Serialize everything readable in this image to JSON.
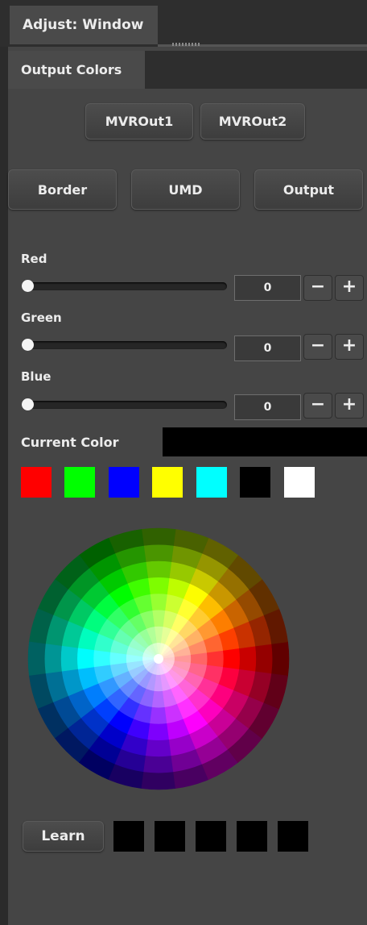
{
  "header": {
    "title": "Adjust: Window"
  },
  "tab": {
    "label": "Output Colors"
  },
  "outputs": [
    {
      "label": "MVROut1"
    },
    {
      "label": "MVROut2"
    }
  ],
  "targets": [
    {
      "label": "Border"
    },
    {
      "label": "UMD"
    },
    {
      "label": "Output"
    }
  ],
  "sliders": [
    {
      "label": "Red",
      "value": "0",
      "level": 0,
      "minus": "−",
      "plus": "+"
    },
    {
      "label": "Green",
      "value": "0",
      "level": 0,
      "minus": "−",
      "plus": "+"
    },
    {
      "label": "Blue",
      "value": "0",
      "level": 0,
      "minus": "−",
      "plus": "+"
    }
  ],
  "current_color": {
    "label": "Current Color",
    "color": "#000000"
  },
  "swatches": [
    "#ff0000",
    "#00ff00",
    "#0000ff",
    "#ffff00",
    "#00ffff",
    "#000000",
    "#ffffff"
  ],
  "color_wheel": {
    "icon": "color-wheel"
  },
  "learn": {
    "label": "Learn",
    "slots": [
      "#000000",
      "#000000",
      "#000000",
      "#000000",
      "#000000"
    ]
  }
}
